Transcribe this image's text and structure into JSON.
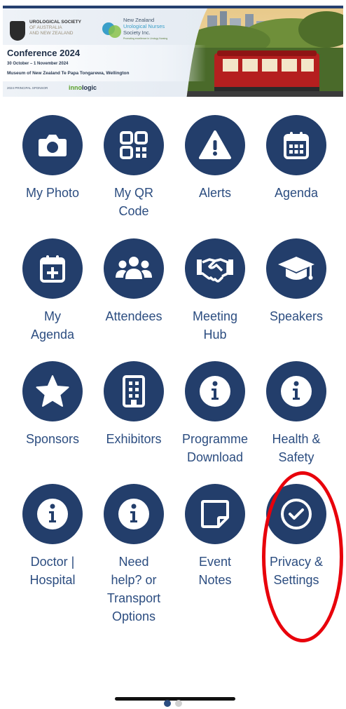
{
  "banner": {
    "society_line1": "UROLOGICAL SOCIETY",
    "society_line2": "OF AUSTRALIA",
    "society_line3": "AND NEW ZEALAND",
    "nz_line1": "New Zealand",
    "nz_line2": "Urological Nurses",
    "nz_line3": "Society Inc.",
    "nz_tagline": "Promoting excellence in Urology Nursing",
    "conference_title": "Conference 2024",
    "conference_dates": "30 October – 1 November 2024",
    "conference_venue": "Museum of New Zealand Te Papa Tongarewa, Wellington",
    "sponsor_label": "2024 PRINCIPAL SPONSOR",
    "sponsor_name_a": "inno",
    "sponsor_name_b": "logic"
  },
  "tiles": [
    {
      "label": "My Photo",
      "icon": "camera-icon"
    },
    {
      "label": "My QR\nCode",
      "icon": "qr-code-icon"
    },
    {
      "label": "Alerts",
      "icon": "alert-triangle-icon"
    },
    {
      "label": "Agenda",
      "icon": "calendar-icon"
    },
    {
      "label": "My\nAgenda",
      "icon": "calendar-plus-icon"
    },
    {
      "label": "Attendees",
      "icon": "users-icon"
    },
    {
      "label": "Meeting\nHub",
      "icon": "handshake-icon"
    },
    {
      "label": "Speakers",
      "icon": "graduation-cap-icon"
    },
    {
      "label": "Sponsors",
      "icon": "star-icon"
    },
    {
      "label": "Exhibitors",
      "icon": "building-icon"
    },
    {
      "label": "Programme\nDownload",
      "icon": "info-icon"
    },
    {
      "label": "Health &\nSafety",
      "icon": "info-icon"
    },
    {
      "label": "Doctor |\nHospital",
      "icon": "info-icon"
    },
    {
      "label": "Need\nhelp? or\nTransport\nOptions",
      "icon": "info-icon"
    },
    {
      "label": "Event\nNotes",
      "icon": "sticky-note-icon"
    },
    {
      "label": "Privacy &\nSettings",
      "icon": "check-circle-icon"
    }
  ],
  "colors": {
    "icon_bg": "#233e6b",
    "label": "#2c4d80",
    "highlight": "#e8000b"
  }
}
